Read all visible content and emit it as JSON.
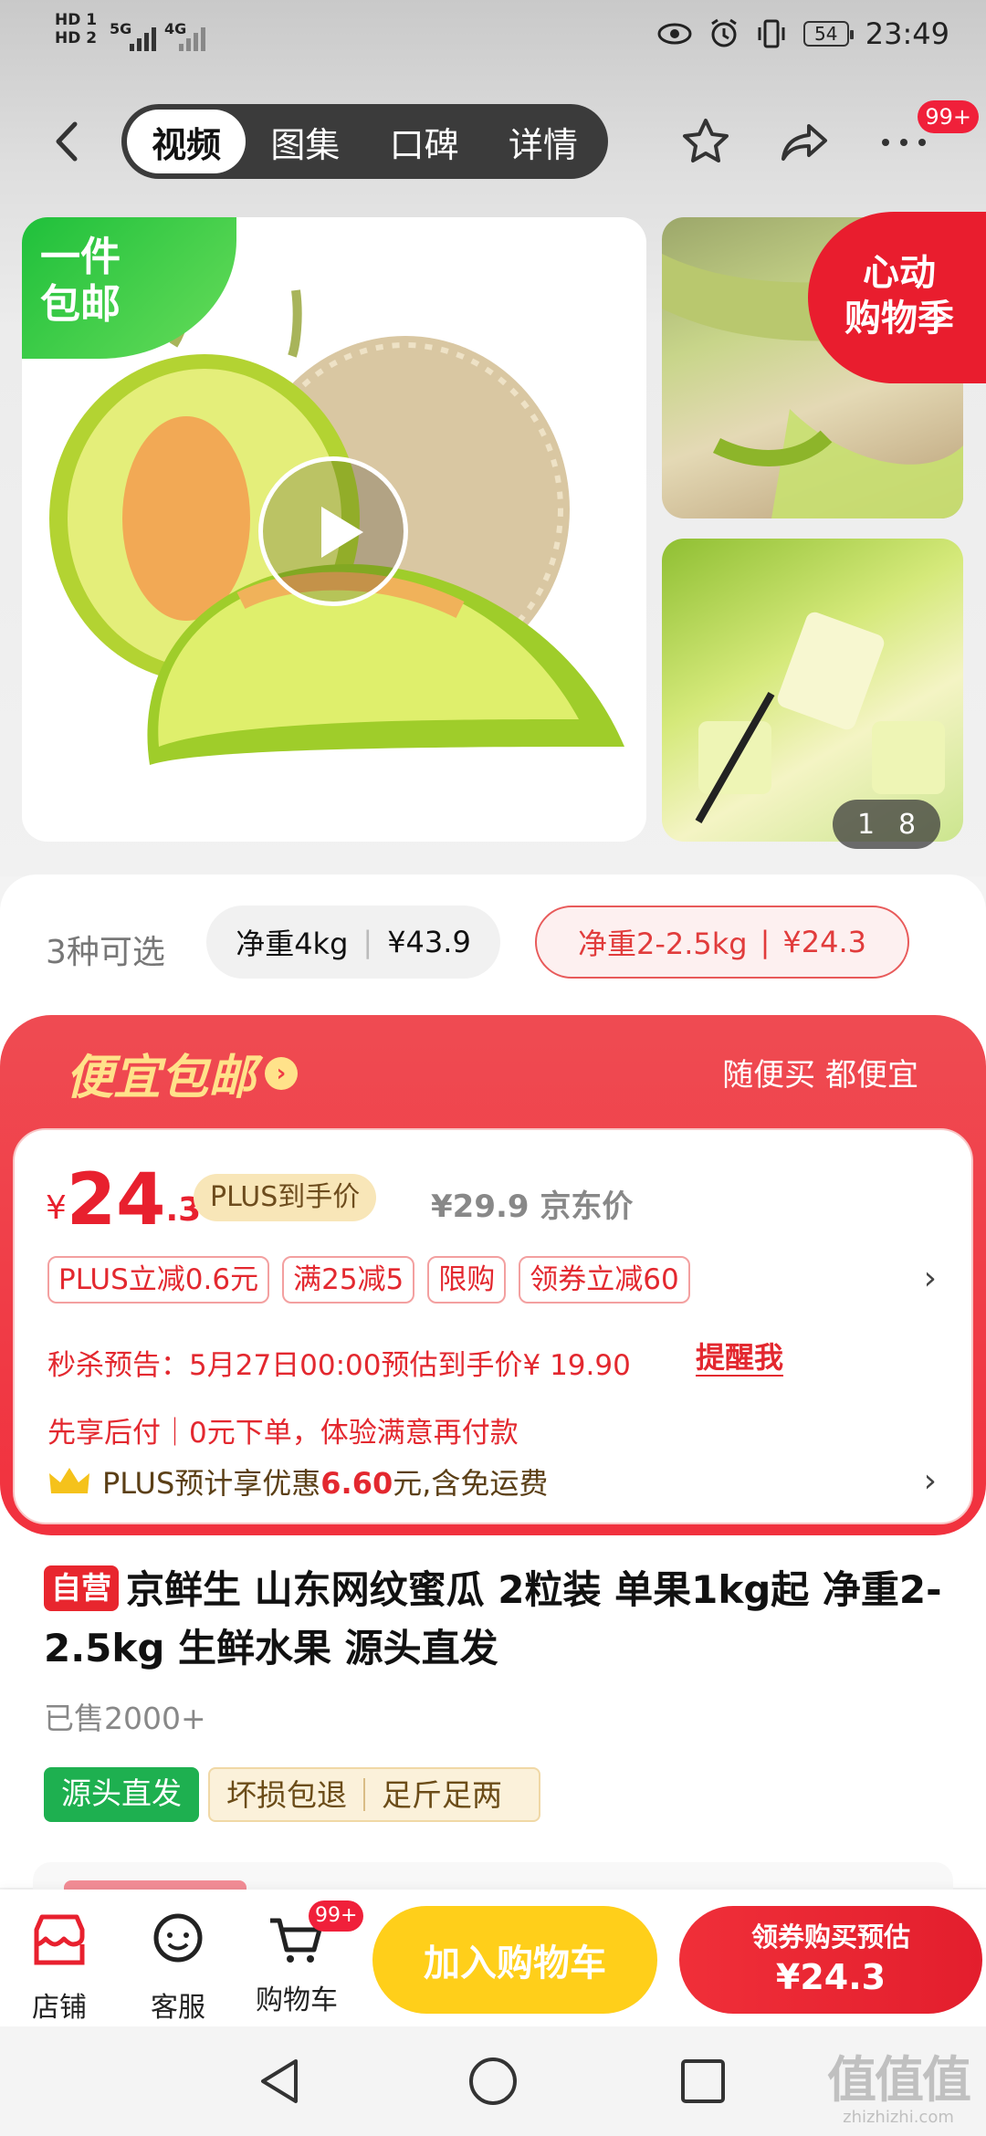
{
  "status_bar": {
    "hd1": "HD 1",
    "hd2": "HD 2",
    "net1": "5G",
    "net2": "4G",
    "battery": "54",
    "time": "23:49"
  },
  "nav": {
    "tabs": [
      {
        "label": "视频",
        "active": true
      },
      {
        "label": "图集",
        "active": false
      },
      {
        "label": "口碑",
        "active": false
      },
      {
        "label": "详情",
        "active": false
      }
    ],
    "badge": "99+",
    "icons": [
      "back-arrow-icon",
      "star-icon",
      "share-icon",
      "more-icon"
    ]
  },
  "gallery": {
    "ribbon_line1": "一件",
    "ribbon_line2": "包邮",
    "promo_line1": "心动",
    "promo_line2": "购物季",
    "counter_current": "1",
    "counter_total": "8"
  },
  "variants": {
    "count": "3种可选",
    "options": [
      {
        "label": "净重4kg",
        "price": "¥43.9",
        "selected": false
      },
      {
        "label": "净重2-2.5kg",
        "price": "¥24.3",
        "selected": true
      }
    ]
  },
  "promo_panel": {
    "headline": "便宜包邮",
    "slogan": "随便买 都便宜",
    "price_symbol": "¥",
    "price_int": "24",
    "price_dec": ".3",
    "plus_tag": "PLUS到手价",
    "orig_price": "¥29.9 京东价",
    "tags": [
      "PLUS立减0.6元",
      "满25减5",
      "限购",
      "领券立减60"
    ],
    "flash_notice": "秒杀预告：5月27日00:00预估到手价¥ 19.90",
    "remind": "提醒我",
    "pay_later": "先享后付｜0元下单，体验满意再付款",
    "plus_prefix": "PLUS预计享优惠",
    "plus_value": "6.60",
    "plus_suffix": "元,含免运费"
  },
  "product": {
    "self_tag": "自营",
    "title": "京鲜生 山东网纹蜜瓜 2粒装 单果1kg起 净重2-2.5kg 生鲜水果 源头直发",
    "sold": "已售2000+",
    "feature_green": "源头直发",
    "features": [
      "坏损包退",
      "足斤足两"
    ]
  },
  "action_bar": {
    "store": "店铺",
    "service": "客服",
    "cart": "购物车",
    "cart_badge": "99+",
    "add_cart": "加入购物车",
    "buy_line1": "领券购买预估",
    "buy_line2": "¥24.3"
  },
  "watermark": {
    "big": "值值值",
    "small": "zhizhizhi.com"
  },
  "colors": {
    "accent_red": "#e8202e",
    "yellow_button": "#ffcf1a",
    "green_tag": "#1eb050",
    "plus_gold": "#f8e6b8"
  }
}
